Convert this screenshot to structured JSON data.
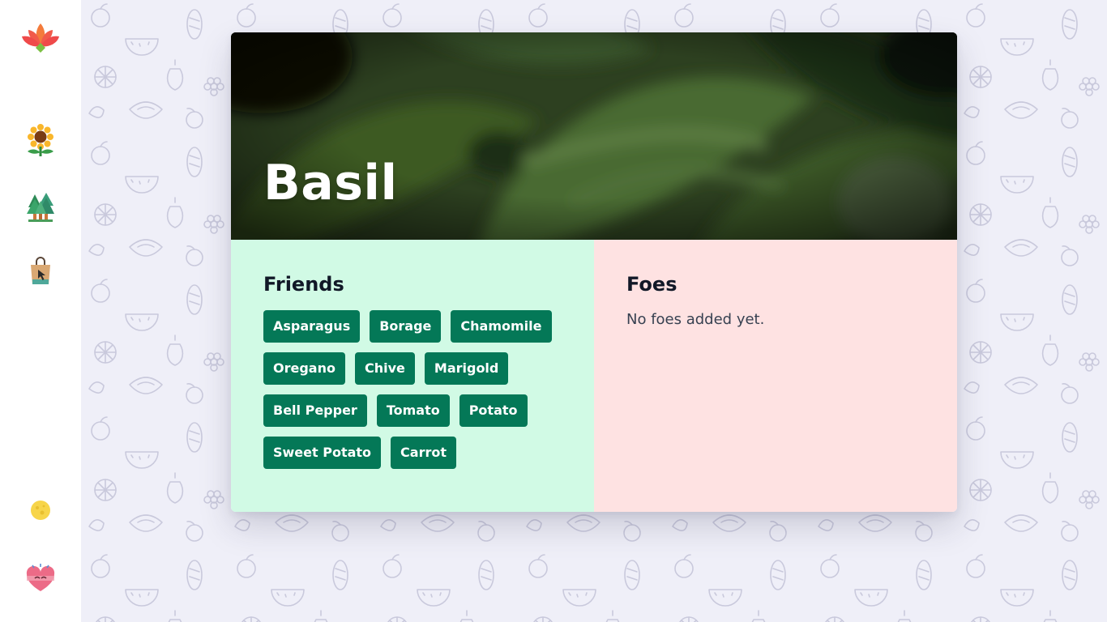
{
  "plant": {
    "name": "Basil"
  },
  "sidebar": {
    "items": [
      {
        "icon": "lotus-logo-icon"
      },
      {
        "icon": "sunflower-icon"
      },
      {
        "icon": "trees-icon"
      },
      {
        "icon": "shopping-bag-icon"
      },
      {
        "icon": "moon-icon"
      },
      {
        "icon": "heart-icon"
      }
    ]
  },
  "friends": {
    "title": "Friends",
    "items": [
      "Asparagus",
      "Borage",
      "Chamomile",
      "Oregano",
      "Chive",
      "Marigold",
      "Bell Pepper",
      "Tomato",
      "Potato",
      "Sweet Potato",
      "Carrot"
    ]
  },
  "foes": {
    "title": "Foes",
    "empty_message": "No foes added yet."
  },
  "colors": {
    "friends_background": "#d1fae5",
    "foes_background": "#fee2e2",
    "tag_background": "#047857",
    "page_background": "#efeff8"
  }
}
